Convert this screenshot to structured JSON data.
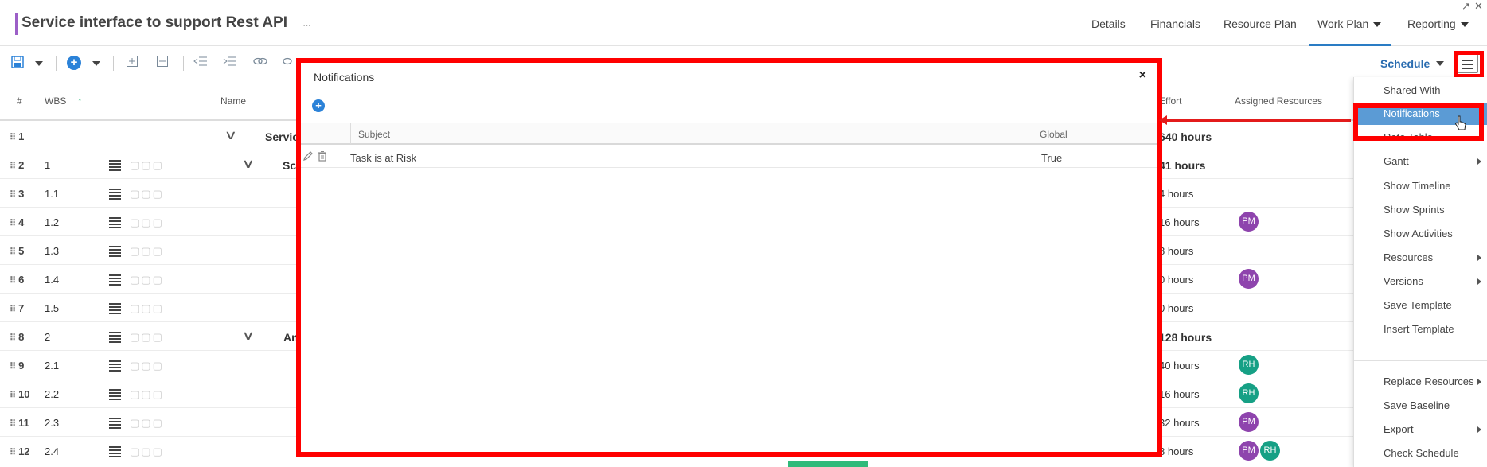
{
  "header": {
    "title": "Service interface to support Rest API",
    "title_more": "···",
    "nav": [
      "Details",
      "Financials",
      "Resource Plan",
      "Work Plan",
      "Reporting"
    ],
    "window_icons": [
      "↗",
      "✕"
    ]
  },
  "toolbar": {
    "schedule_label": "Schedule"
  },
  "grid": {
    "columns": [
      "#",
      "WBS",
      "Name",
      "Effort",
      "Assigned Resources"
    ],
    "rows": [
      {
        "num": "1",
        "wbs": "",
        "name": "Servic",
        "effort": "640 hours",
        "avatars": []
      },
      {
        "num": "2",
        "wbs": "1",
        "name": "Sc",
        "effort": "41 hours",
        "avatars": []
      },
      {
        "num": "3",
        "wbs": "1.1",
        "name": "",
        "effort": "4 hours",
        "avatars": []
      },
      {
        "num": "4",
        "wbs": "1.2",
        "name": "",
        "effort": "16 hours",
        "avatars": [
          "PM"
        ]
      },
      {
        "num": "5",
        "wbs": "1.3",
        "name": "",
        "effort": "8 hours",
        "avatars": []
      },
      {
        "num": "6",
        "wbs": "1.4",
        "name": "",
        "effort": "0 hours",
        "avatars": [
          "PM"
        ]
      },
      {
        "num": "7",
        "wbs": "1.5",
        "name": "",
        "effort": "0 hours",
        "avatars": []
      },
      {
        "num": "8",
        "wbs": "2",
        "name": "An",
        "effort": "128 hours",
        "avatars": []
      },
      {
        "num": "9",
        "wbs": "2.1",
        "name": "",
        "effort": "40 hours",
        "avatars": [
          "RH"
        ]
      },
      {
        "num": "10",
        "wbs": "2.2",
        "name": "",
        "effort": "16 hours",
        "avatars": [
          "RH"
        ]
      },
      {
        "num": "11",
        "wbs": "2.3",
        "name": "",
        "effort": "32 hours",
        "avatars": [
          "PM"
        ]
      },
      {
        "num": "12",
        "wbs": "2.4",
        "name": "",
        "effort": "8 hours",
        "avatars": [
          "PM",
          "RH"
        ]
      }
    ],
    "avatar_colors": {
      "PM": "#8e44ad",
      "RH": "#16a085"
    }
  },
  "modal": {
    "title": "Notifications",
    "close": "×",
    "add": "+",
    "columns": [
      "Subject",
      "Global"
    ],
    "rows": [
      {
        "subject": "Task is at Risk",
        "global": "True"
      }
    ]
  },
  "menu": {
    "items": [
      {
        "label": "Shared With",
        "submenu": false
      },
      {
        "label": "Notifications",
        "submenu": false,
        "highlighted": true
      },
      {
        "label": "Rate Table",
        "submenu": false
      },
      {
        "label": "Gantt",
        "submenu": true
      },
      {
        "label": "Show Timeline",
        "submenu": false
      },
      {
        "label": "Show Sprints",
        "submenu": false
      },
      {
        "label": "Show Activities",
        "submenu": false
      },
      {
        "label": "Resources",
        "submenu": true
      },
      {
        "label": "Versions",
        "submenu": true
      },
      {
        "label": "Save Template",
        "submenu": false
      },
      {
        "label": "Insert Template",
        "submenu": false
      },
      {
        "label": "Replace Resources",
        "submenu": true
      },
      {
        "label": "Save Baseline",
        "submenu": false
      },
      {
        "label": "Export",
        "submenu": true
      },
      {
        "label": "Check Schedule",
        "submenu": false
      }
    ]
  },
  "colors": {
    "accent": "#9c5fc7",
    "primary": "#2a7cc4",
    "highlight": "#5b9bd5",
    "annotation": "#ff0000"
  }
}
